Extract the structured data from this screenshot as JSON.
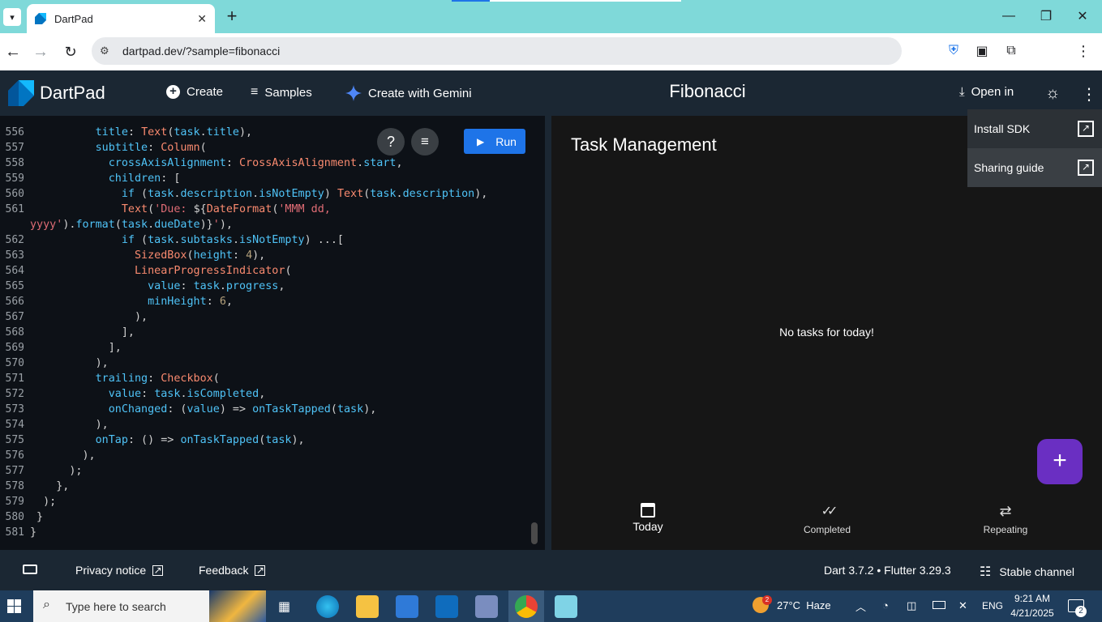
{
  "browser": {
    "tab_title": "DartPad",
    "url": "dartpad.dev/?sample=fibonacci"
  },
  "dartpad": {
    "logo_label": "DartPad",
    "create_label": "Create",
    "samples_label": "Samples",
    "gemini_label": "Create with Gemini",
    "title": "Fibonacci",
    "open_in_label": "Open in",
    "menu": [
      "Install SDK",
      "Sharing guide"
    ],
    "run_label": "Run"
  },
  "editor": {
    "line_numbers": [
      "556",
      "557",
      "558",
      "559",
      "560",
      "561",
      "",
      "562",
      "563",
      "564",
      "565",
      "566",
      "567",
      "568",
      "569",
      "570",
      "571",
      "572",
      "573",
      "574",
      "575",
      "576",
      "577",
      "578",
      "579",
      "580",
      "581"
    ]
  },
  "preview": {
    "app_title": "Task Management",
    "empty_message": "No tasks for today!",
    "fab_icon": "plus-icon",
    "nav": [
      {
        "label": "Today",
        "icon": "calendar-icon"
      },
      {
        "label": "Completed",
        "icon": "double-check-icon"
      },
      {
        "label": "Repeating",
        "icon": "repeat-icon"
      }
    ]
  },
  "footer": {
    "privacy_label": "Privacy notice",
    "feedback_label": "Feedback",
    "version_label": "Dart 3.7.2 • Flutter 3.29.3",
    "channel_label": "Stable channel"
  },
  "taskbar": {
    "search_placeholder": "Type here to search",
    "weather": "27°C  Haze",
    "weather_badge": "2",
    "lang": "ENG",
    "time": "9:21 AM",
    "date": "4/21/2025",
    "notif_count": "2"
  },
  "colors": {
    "accent": "#1e74e8",
    "fab": "#6a2fc2",
    "header_bg": "#1b2733"
  }
}
